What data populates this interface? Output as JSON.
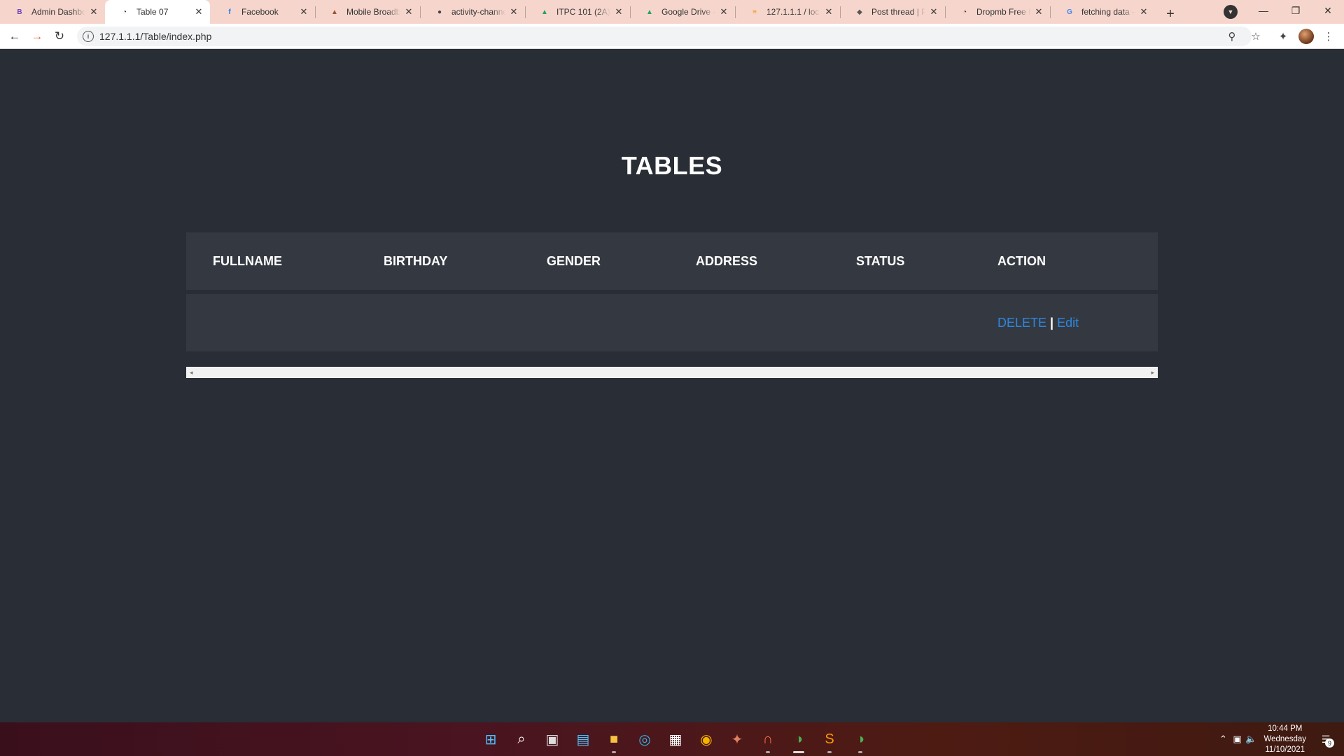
{
  "browser": {
    "tabs": [
      {
        "title": "Admin Dashboa",
        "favicon": "bootstrap-icon",
        "favicon_glyph": "B",
        "favicon_color": "#6f42c1",
        "active": false
      },
      {
        "title": "Table 07",
        "favicon": "globe-icon",
        "favicon_glyph": "◔",
        "favicon_color": "#333333",
        "active": true
      },
      {
        "title": "Facebook",
        "favicon": "facebook-icon",
        "favicon_glyph": "f",
        "favicon_color": "#1877f2",
        "active": false
      },
      {
        "title": "Mobile Broadba",
        "favicon": "mobile-broadband-icon",
        "favicon_glyph": "▲",
        "favicon_color": "#a0522d",
        "active": false
      },
      {
        "title": "activity-channel",
        "favicon": "github-icon",
        "favicon_glyph": "●",
        "favicon_color": "#444444",
        "active": false
      },
      {
        "title": "ITPC 101 (2A) (2",
        "favicon": "google-drive-icon",
        "favicon_glyph": "▲",
        "favicon_color": "#1fa463",
        "active": false
      },
      {
        "title": "Google Drive - ",
        "favicon": "google-drive-icon",
        "favicon_glyph": "▲",
        "favicon_color": "#1fa463",
        "active": false
      },
      {
        "title": "127.1.1.1 / local",
        "favicon": "phpmyadmin-icon",
        "favicon_glyph": "≡",
        "favicon_color": "#f29111",
        "active": false
      },
      {
        "title": "Post thread | Pin",
        "favicon": "forum-icon",
        "favicon_glyph": "◆",
        "favicon_color": "#555555",
        "active": false
      },
      {
        "title": "Dropmb Free Fi",
        "favicon": "globe-icon",
        "favicon_glyph": "◔",
        "favicon_color": "#333333",
        "active": false
      },
      {
        "title": "fetching data - ",
        "favicon": "google-icon",
        "favicon_glyph": "G",
        "favicon_color": "#4285f4",
        "active": false
      }
    ],
    "newtab_label": "+",
    "url": "127.1.1.1/Table/index.php"
  },
  "page": {
    "title": "TABLES",
    "columns": [
      "FULLNAME",
      "BIRTHDAY",
      "GENDER",
      "ADDRESS",
      "STATUS",
      "ACTION"
    ],
    "rows": [
      {
        "fullname": "",
        "birthday": "",
        "gender": "",
        "address": "",
        "status": "",
        "delete_label": "DELETE",
        "separator": "|",
        "edit_label": "Edit"
      }
    ],
    "scroll_left": "◂",
    "scroll_right": "▸"
  },
  "taskbar": {
    "apps": [
      {
        "name": "start-icon",
        "glyph": "⊞",
        "color": "#4cc2ff",
        "running": false
      },
      {
        "name": "search-icon",
        "glyph": "⌕",
        "color": "#ffffff",
        "running": false
      },
      {
        "name": "task-view-icon",
        "glyph": "▣",
        "color": "#dddddd",
        "running": false
      },
      {
        "name": "widgets-icon",
        "glyph": "▤",
        "color": "#4cc2ff",
        "running": false
      },
      {
        "name": "file-explorer-icon",
        "glyph": "■",
        "color": "#f6c343",
        "running": true
      },
      {
        "name": "edge-icon",
        "glyph": "◎",
        "color": "#2fb3e8",
        "running": false
      },
      {
        "name": "store-icon",
        "glyph": "▦",
        "color": "#ffffff",
        "running": false
      },
      {
        "name": "chrome-icon",
        "glyph": "◉",
        "color": "#f4b400",
        "running": false
      },
      {
        "name": "app-icon",
        "glyph": "✦",
        "color": "#e08060",
        "running": false
      },
      {
        "name": "headset-icon",
        "glyph": "∩",
        "color": "#ff7043",
        "running": true
      },
      {
        "name": "browser-icon",
        "glyph": "◑",
        "color": "#4caf50",
        "running": true,
        "active": true
      },
      {
        "name": "sublime-text-icon",
        "glyph": "S",
        "color": "#ff9800",
        "running": true
      },
      {
        "name": "browser-2-icon",
        "glyph": "◑",
        "color": "#4caf50",
        "running": true
      }
    ],
    "tray": {
      "time": "10:44 PM",
      "day": "Wednesday",
      "date": "11/10/2021",
      "notification_count": "9"
    }
  },
  "colors": {
    "page_background": "#292d35",
    "row_background": "#343941",
    "link": "#2e86de",
    "tabstrip": "#f6d6cc"
  }
}
